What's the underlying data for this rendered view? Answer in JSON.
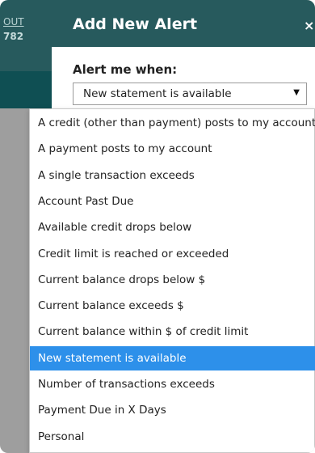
{
  "background": {
    "link_text": "OUT",
    "digits_text": "782"
  },
  "modal": {
    "title": "Add New Alert",
    "close_glyph": "×",
    "alert_label": "Alert me when:",
    "select_value": "New statement is available",
    "select_arrow_glyph": "▼"
  },
  "dropdown": {
    "selected_index": 10,
    "options": [
      "A credit (other than payment) posts to my account",
      "A payment posts to my account",
      "A single transaction exceeds",
      "Account Past Due",
      "Available credit drops below",
      "Credit limit is reached or exceeded",
      "Current balance drops below $",
      "Current balance exceeds $",
      "Current balance within $ of credit limit",
      "New statement is available",
      "Number of transactions exceeds",
      "Payment Due in X Days",
      "Personal"
    ]
  },
  "colors": {
    "header_teal": "#275a5d",
    "band_teal": "#0f4f53",
    "selected_blue": "#2d90ea"
  }
}
